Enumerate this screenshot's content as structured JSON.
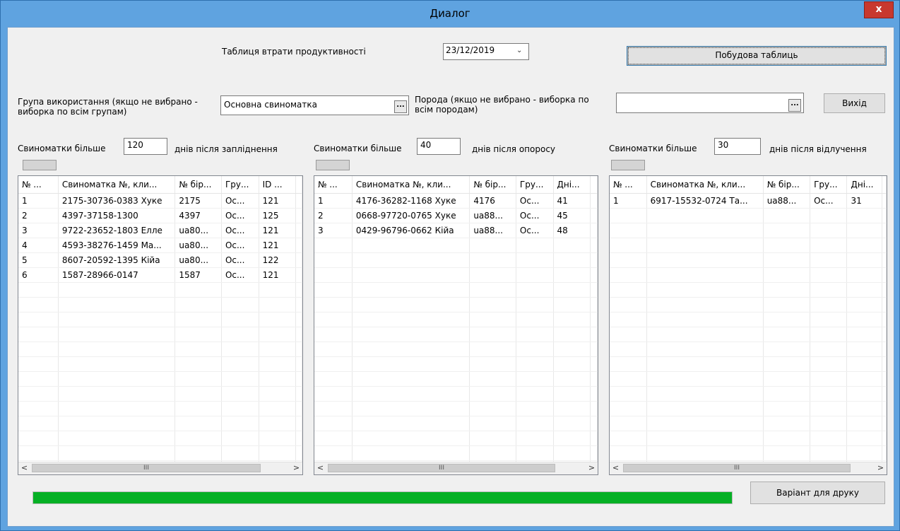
{
  "window": {
    "title": "Диалог",
    "close_label": "x"
  },
  "header": {
    "table_label": "Таблиця втрати продуктивності",
    "date_value": "23/12/2019",
    "build_button": "Побудова таблиць"
  },
  "filters": {
    "group_label": "Група використання (якщо не вибрано - виборка по всім групам)",
    "group_value": "Основна свиноматка",
    "breed_label": "Порода (якщо не вибрано - виборка по всім породам)",
    "breed_value": "",
    "ellipsis": "...",
    "exit_button": "Вихід"
  },
  "panels": [
    {
      "prefix": "Свиноматки більше",
      "value": "120",
      "suffix": "днів після запліднення",
      "columns": [
        "№ ...",
        "Свиноматка №, кли...",
        "№ бір...",
        "Гру...",
        "ID ..."
      ],
      "rows": [
        [
          "1",
          "2175-30736-0383 Хуке",
          "2175",
          "Ос...",
          "121"
        ],
        [
          "2",
          "4397-37158-1300",
          "4397",
          "Ос...",
          "125"
        ],
        [
          "3",
          "9722-23652-1803 Елле",
          "ua80...",
          "Ос...",
          "121"
        ],
        [
          "4",
          "4593-38276-1459 Ма...",
          "ua80...",
          "Ос...",
          "121"
        ],
        [
          "5",
          "8607-20592-1395 Кійа",
          "ua80...",
          "Ос...",
          "122"
        ],
        [
          "6",
          "1587-28966-0147",
          "1587",
          "Ос...",
          "121"
        ]
      ]
    },
    {
      "prefix": "Свиноматки більше",
      "value": "40",
      "suffix": "днів після опоросу",
      "columns": [
        "№ ...",
        "Свиноматка №, кли...",
        "№ бір...",
        "Гру...",
        "Дні..."
      ],
      "rows": [
        [
          "1",
          "4176-36282-1168 Хуке",
          "4176",
          "Ос...",
          "41"
        ],
        [
          "2",
          "0668-97720-0765 Хуке",
          "ua88...",
          "Ос...",
          "45"
        ],
        [
          "3",
          "0429-96796-0662 Кійа",
          "ua88...",
          "Ос...",
          "48"
        ]
      ]
    },
    {
      "prefix": "Свиноматки більше",
      "value": "30",
      "suffix": "днів після відлучення",
      "columns": [
        "№ ...",
        "Свиноматка №, кли...",
        "№ бір...",
        "Гру...",
        "Дні..."
      ],
      "rows": [
        [
          "1",
          "6917-15532-0724 Та...",
          "ua88...",
          "Ос...",
          "31"
        ]
      ]
    }
  ],
  "scrollbar": {
    "left": "<",
    "right": ">",
    "grip": "III"
  },
  "progress": {
    "fraction": 1.0,
    "color": "#06b025"
  },
  "print_button": "Варіант для друку"
}
